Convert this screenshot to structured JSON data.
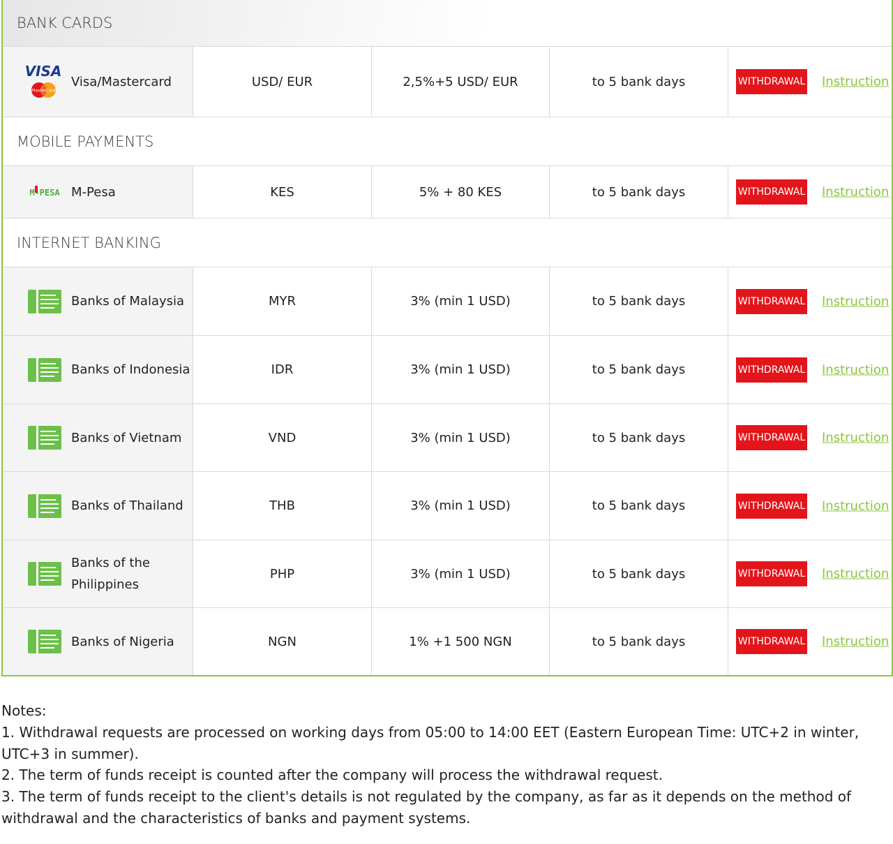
{
  "sections": {
    "bank_cards": "BANK CARDS",
    "mobile_payments": "MOBILE PAYMENTS",
    "internet_banking": "INTERNET BANKING"
  },
  "logos": {
    "visa_text": "VISA",
    "mastercard_text": "MasterCard",
    "mpesa_text": "M-PESA"
  },
  "rows": [
    {
      "name": "Visa/Mastercard",
      "currency": "USD/ EUR",
      "fee": "2,5%+5 USD/ EUR",
      "term": "to 5 bank days",
      "button": "WITHDRAWAL",
      "link": "Instruction",
      "icon": "visa-mastercard-logo"
    },
    {
      "name": "M-Pesa",
      "currency": "KES",
      "fee": "5% + 80 KES",
      "term": "to 5 bank days",
      "button": "WITHDRAWAL",
      "link": "Instruction",
      "icon": "mpesa-logo"
    },
    {
      "name": "Banks of Malaysia",
      "currency": "MYR",
      "fee": "3% (min 1 USD)",
      "term": "to 5 bank days",
      "button": "WITHDRAWAL",
      "link": "Instruction",
      "icon": "bank-transfer-icon"
    },
    {
      "name": "Banks of Indonesia",
      "currency": "IDR",
      "fee": "3% (min 1 USD)",
      "term": "to 5 bank days",
      "button": "WITHDRAWAL",
      "link": "Instruction",
      "icon": "bank-transfer-icon"
    },
    {
      "name": "Banks of Vietnam",
      "currency": "VND",
      "fee": "3% (min 1 USD)",
      "term": "to 5 bank days",
      "button": "WITHDRAWAL",
      "link": "Instruction",
      "icon": "bank-transfer-icon"
    },
    {
      "name": "Banks of Thailand",
      "currency": "THB",
      "fee": "3% (min 1 USD)",
      "term": "to 5 bank days",
      "button": "WITHDRAWAL",
      "link": "Instruction",
      "icon": "bank-transfer-icon"
    },
    {
      "name": "Banks of the Philippines",
      "name_line1": "Banks of the",
      "name_line2": "Philippines",
      "currency": "PHP",
      "fee": "3% (min 1 USD)",
      "term": "to 5 bank days",
      "button": "WITHDRAWAL",
      "link": "Instruction",
      "icon": "bank-transfer-icon"
    },
    {
      "name": "Banks of Nigeria",
      "currency": "NGN",
      "fee": "1% +1 500 NGN",
      "term": "to 5 bank days",
      "button": "WITHDRAWAL",
      "link": "Instruction",
      "icon": "bank-transfer-icon"
    }
  ],
  "notes": {
    "title": "Notes:",
    "items": [
      "1. Withdrawal requests are processed on working days from 05:00 to 14:00 EET (Eastern European Time: UTC+2 in winter, UTC+3 in summer).",
      "2. The term of funds receipt is counted after the company will process the withdrawal request.",
      "3. The term of funds receipt to the client's details is not regulated by the company, as far as it depends on the method of withdrawal and the characteristics of banks and payment systems."
    ]
  },
  "colors": {
    "accent_green": "#8cc63f",
    "button_red": "#e3151b",
    "bank_icon_green": "#6cc04a"
  }
}
